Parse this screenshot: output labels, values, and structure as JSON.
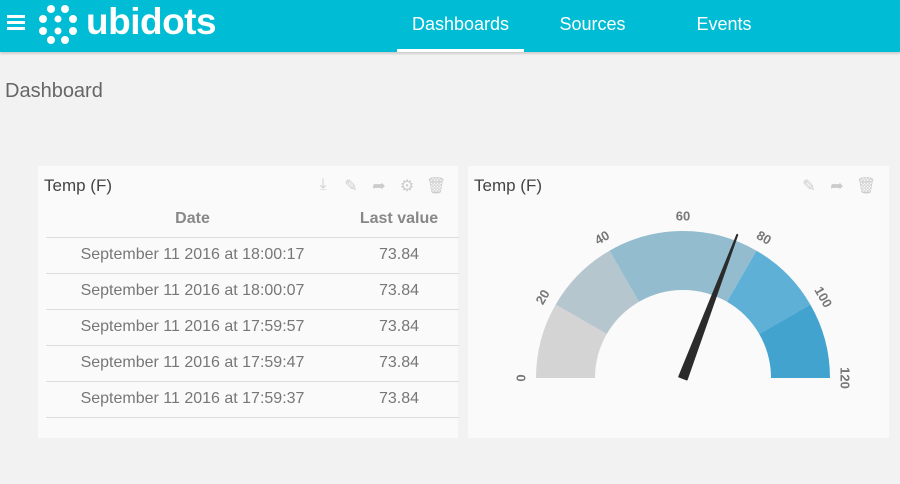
{
  "header": {
    "brand": "ubidots",
    "nav": [
      {
        "label": "Dashboards",
        "active": true
      },
      {
        "label": "Sources",
        "active": false
      },
      {
        "label": "Events",
        "active": false
      }
    ],
    "color": "#00bcd4"
  },
  "page_title": "Dashboard",
  "table_widget": {
    "title": "Temp (F)",
    "icons": [
      "download-icon",
      "pencil-icon",
      "share-icon",
      "gear-icon",
      "trash-icon"
    ],
    "columns": [
      "Date",
      "Last value"
    ],
    "rows": [
      [
        "September 11 2016 at 18:00:17",
        "73.84"
      ],
      [
        "September 11 2016 at 18:00:07",
        "73.84"
      ],
      [
        "September 11 2016 at 17:59:57",
        "73.84"
      ],
      [
        "September 11 2016 at 17:59:47",
        "73.84"
      ],
      [
        "September 11 2016 at 17:59:37",
        "73.84"
      ]
    ]
  },
  "gauge_widget": {
    "title": "Temp (F)",
    "icons": [
      "pencil-icon",
      "share-icon",
      "trash-icon"
    ],
    "min": 0,
    "max": 120,
    "value": 73.84,
    "ticks": [
      "0",
      "20",
      "40",
      "60",
      "80",
      "100",
      "120"
    ],
    "band_colors": [
      "#d4d4d4",
      "#b5c6cf",
      "#93bccf",
      "#93bccf",
      "#5eb0d6",
      "#43a3cf"
    ]
  }
}
